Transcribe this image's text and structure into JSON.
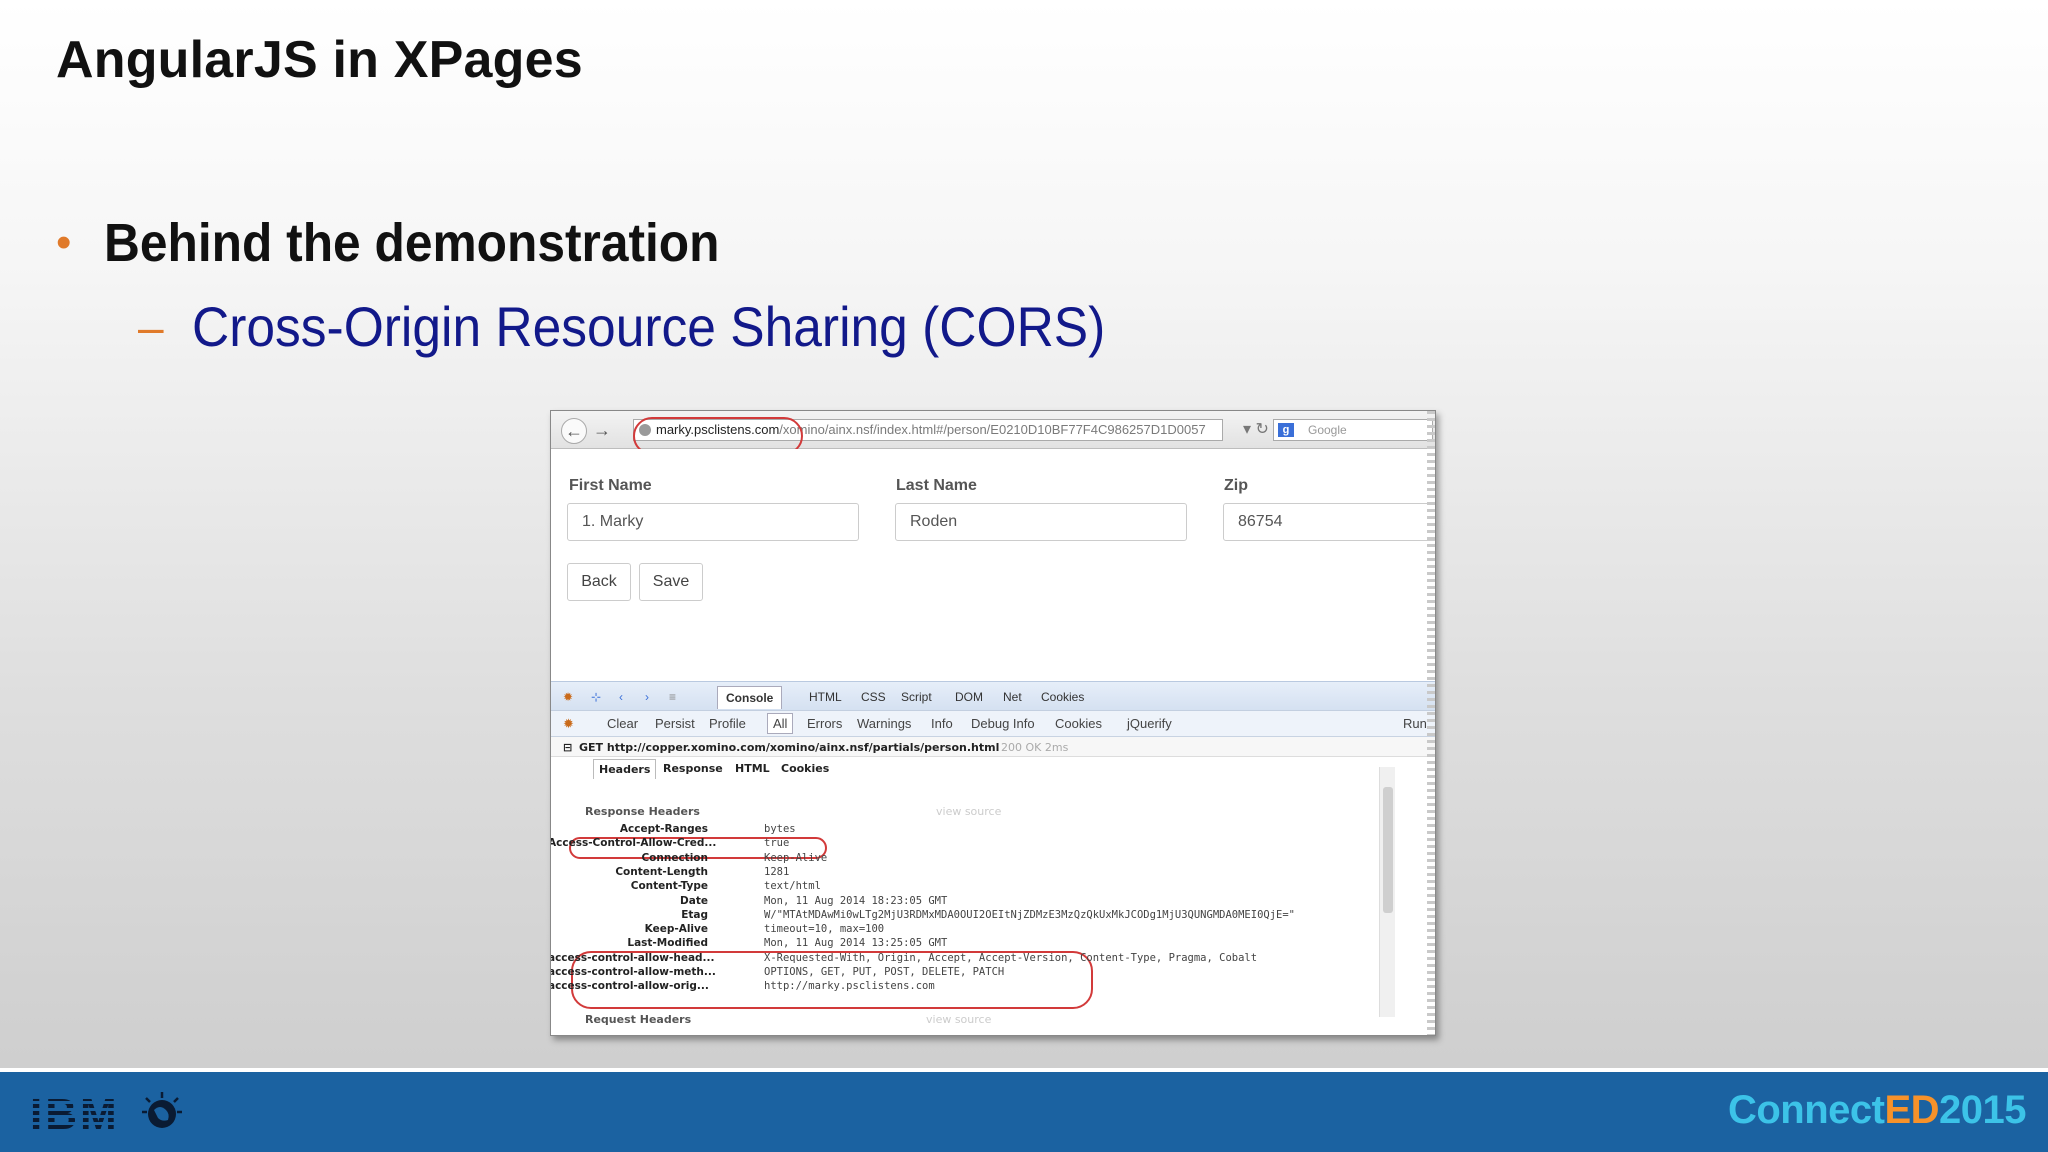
{
  "slide": {
    "title": "AngularJS in XPages",
    "bullet1": "Behind the demonstration",
    "bullet2": "Cross-Origin Resource Sharing (CORS)"
  },
  "browser": {
    "url_host": "marky.psclistens.com",
    "url_path": "/xomino/ainx.nsf/index.html#/person/E0210D10BF77F4C986257D1D0057",
    "search_placeholder": "Google"
  },
  "form": {
    "first_name_label": "First Name",
    "first_name_value": "1. Marky",
    "last_name_label": "Last Name",
    "last_name_value": "Roden",
    "zip_label": "Zip",
    "zip_value": "86754",
    "back_label": "Back",
    "save_label": "Save"
  },
  "firebug": {
    "tabs": [
      "Console",
      "HTML",
      "CSS",
      "Script",
      "DOM",
      "Net",
      "Cookies"
    ],
    "sub": [
      "Clear",
      "Persist",
      "Profile",
      "All",
      "Errors",
      "Warnings",
      "Info",
      "Debug Info",
      "Cookies",
      "jQuerify",
      "Run"
    ],
    "request": "GET http://copper.xomino.com/xomino/ainx.nsf/partials/person.html",
    "status": "200 OK 2ms",
    "req_tabs": [
      "Headers",
      "Response",
      "HTML",
      "Cookies"
    ],
    "response_headers_label": "Response Headers",
    "request_headers_label": "Request Headers",
    "view_source": "view source",
    "headers": [
      {
        "key": "Accept-Ranges",
        "value": "bytes"
      },
      {
        "key": "Access-Control-Allow-Cred...",
        "value": "true"
      },
      {
        "key": "Connection",
        "value": "Keep-Alive"
      },
      {
        "key": "Content-Length",
        "value": "1281"
      },
      {
        "key": "Content-Type",
        "value": "text/html"
      },
      {
        "key": "Date",
        "value": "Mon, 11 Aug 2014 18:23:05 GMT"
      },
      {
        "key": "Etag",
        "value": "W/\"MTAtMDAwMi0wLTg2MjU3RDMxMDA0OUI2OEItNjZDMzE3MzQzQkUxMkJCODg1MjU3QUNGMDA0MEI0QjE=\""
      },
      {
        "key": "Keep-Alive",
        "value": "timeout=10, max=100"
      },
      {
        "key": "Last-Modified",
        "value": "Mon, 11 Aug 2014 13:25:05 GMT"
      },
      {
        "key": "access-control-allow-head...",
        "value": "X-Requested-With, Origin, Accept, Accept-Version, Content-Type, Pragma, Cobalt"
      },
      {
        "key": "access-control-allow-meth...",
        "value": "OPTIONS, GET, PUT, POST, DELETE, PATCH"
      },
      {
        "key": "access-control-allow-orig...",
        "value": "http://marky.psclistens.com"
      }
    ]
  },
  "footer": {
    "ibm": "IBM",
    "brand_1": "Connect",
    "brand_2": "ED",
    "brand_3": "2015"
  },
  "colors": {
    "bullet": "#e07a2a",
    "subtext": "#12198a",
    "footer": "#1b62a1",
    "highlight": "#d23a3a"
  }
}
